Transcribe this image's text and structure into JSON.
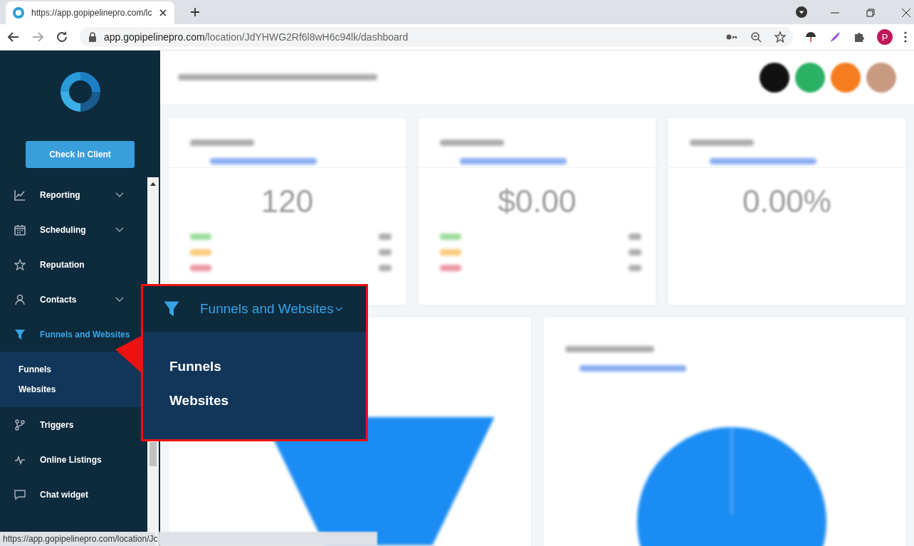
{
  "browser": {
    "tab_title": "https://app.gopipelinepro.com/lc",
    "address_host": "app.gopipelinepro.com",
    "address_path": "/location/JdYHWG2Rf6l8wH6c94lk/dashboard",
    "profile": "P"
  },
  "sidebar": {
    "check_in_button": "Check In Client",
    "items": [
      {
        "label": "Reporting",
        "kind": "menu",
        "selected": false
      },
      {
        "label": "Scheduling",
        "kind": "menu",
        "selected": false
      },
      {
        "label": "Reputation",
        "kind": "link",
        "selected": false
      },
      {
        "label": "Contacts",
        "kind": "menu",
        "selected": false
      },
      {
        "label": "Funnels and Websites",
        "kind": "menu",
        "selected": true,
        "children": [
          {
            "label": "Funnels"
          },
          {
            "label": "Websites"
          }
        ]
      },
      {
        "label": "Triggers",
        "kind": "link",
        "selected": false
      },
      {
        "label": "Online Listings",
        "kind": "link",
        "selected": false
      },
      {
        "label": "Chat widget",
        "kind": "link",
        "selected": false
      }
    ]
  },
  "cards": [
    {
      "value": "120",
      "kind": "breakdown"
    },
    {
      "value": "$0.00",
      "kind": "breakdown"
    },
    {
      "value": "0.00%",
      "kind": "plain"
    }
  ],
  "callout": {
    "title": "Funnels and Websites",
    "items": [
      "Funnels",
      "Websites"
    ]
  },
  "status_url": "https://app.gopipelinepro.com/location/Jc"
}
